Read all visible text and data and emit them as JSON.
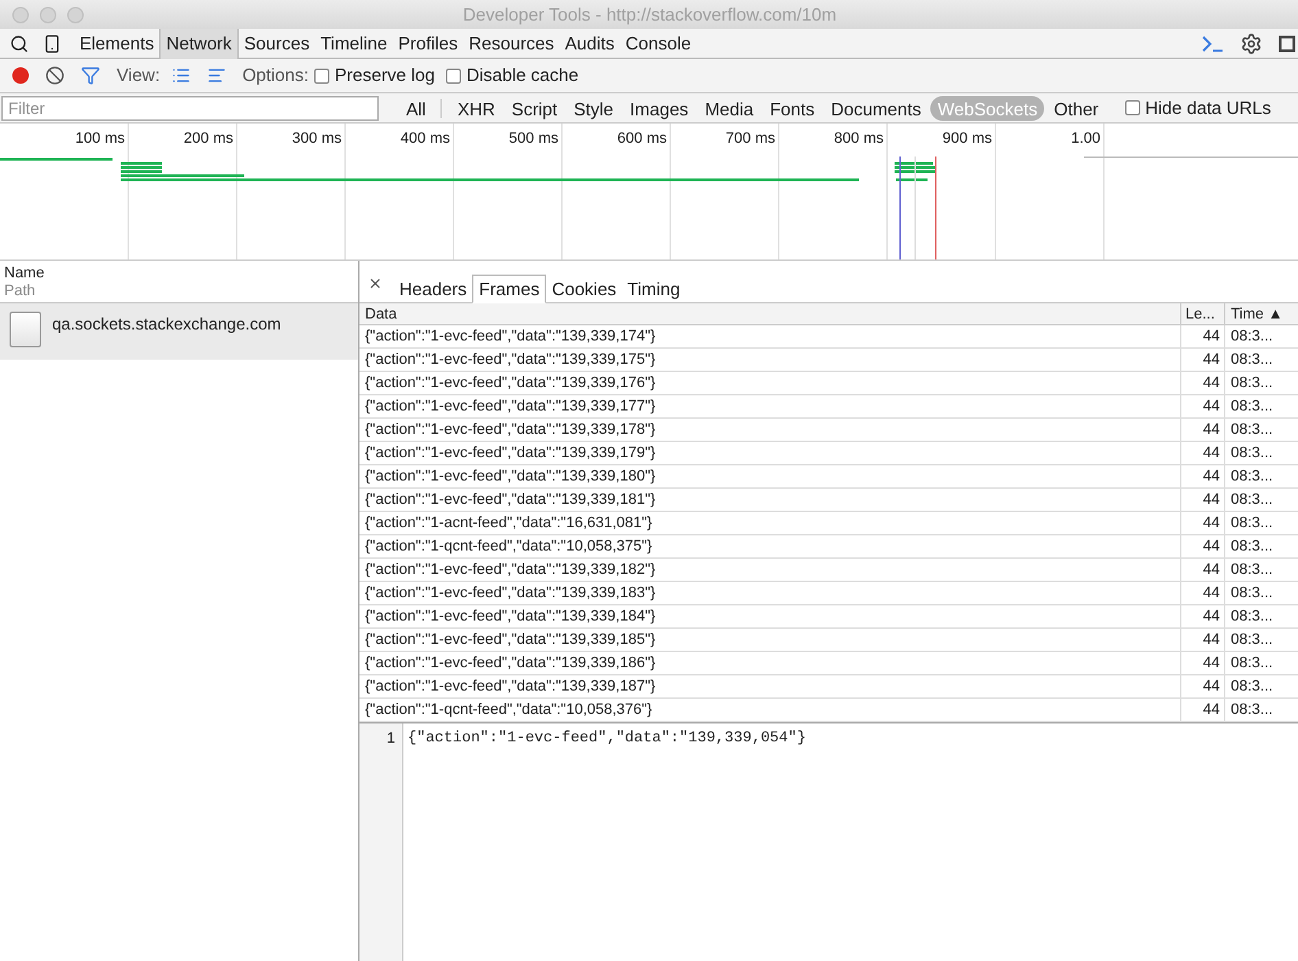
{
  "window": {
    "title": "Developer Tools - http://stackoverflow.com/10m"
  },
  "panels": [
    {
      "label": "Elements",
      "selected": false
    },
    {
      "label": "Network",
      "selected": true
    },
    {
      "label": "Sources",
      "selected": false
    },
    {
      "label": "Timeline",
      "selected": false
    },
    {
      "label": "Profiles",
      "selected": false
    },
    {
      "label": "Resources",
      "selected": false
    },
    {
      "label": "Audits",
      "selected": false
    },
    {
      "label": "Console",
      "selected": false
    }
  ],
  "toolbar": {
    "recording": true,
    "view_label": "View:",
    "options_label": "Options:",
    "options": [
      {
        "label": "Preserve log",
        "checked": false
      },
      {
        "label": "Disable cache",
        "checked": false
      }
    ]
  },
  "filter": {
    "placeholder": "Filter",
    "types": [
      {
        "label": "All",
        "selected": false
      },
      {
        "label": "XHR",
        "selected": false
      },
      {
        "label": "Script",
        "selected": false
      },
      {
        "label": "Style",
        "selected": false
      },
      {
        "label": "Images",
        "selected": false
      },
      {
        "label": "Media",
        "selected": false
      },
      {
        "label": "Fonts",
        "selected": false
      },
      {
        "label": "Documents",
        "selected": false
      },
      {
        "label": "WebSockets",
        "selected": true
      },
      {
        "label": "Other",
        "selected": false
      }
    ],
    "hide_data_urls": {
      "label": "Hide data URLs",
      "checked": false
    }
  },
  "timeline": {
    "ticks": [
      "100 ms",
      "200 ms",
      "300 ms",
      "400 ms",
      "500 ms",
      "600 ms",
      "700 ms",
      "800 ms",
      "900 ms",
      "1.00"
    ]
  },
  "requests": {
    "columns": [
      "Name",
      "Path"
    ],
    "rows": [
      {
        "name": "qa.sockets.stackexchange.com",
        "selected": true
      }
    ]
  },
  "detail_tabs": [
    {
      "label": "Headers",
      "selected": false
    },
    {
      "label": "Frames",
      "selected": true
    },
    {
      "label": "Cookies",
      "selected": false
    },
    {
      "label": "Timing",
      "selected": false
    }
  ],
  "frames": {
    "columns": [
      "Data",
      "Le...",
      "Time ▲"
    ],
    "rows": [
      [
        "{\"action\":\"1-evc-feed\",\"data\":\"139,339,174\"}",
        "44",
        "08:3..."
      ],
      [
        "{\"action\":\"1-evc-feed\",\"data\":\"139,339,175\"}",
        "44",
        "08:3..."
      ],
      [
        "{\"action\":\"1-evc-feed\",\"data\":\"139,339,176\"}",
        "44",
        "08:3..."
      ],
      [
        "{\"action\":\"1-evc-feed\",\"data\":\"139,339,177\"}",
        "44",
        "08:3..."
      ],
      [
        "{\"action\":\"1-evc-feed\",\"data\":\"139,339,178\"}",
        "44",
        "08:3..."
      ],
      [
        "{\"action\":\"1-evc-feed\",\"data\":\"139,339,179\"}",
        "44",
        "08:3..."
      ],
      [
        "{\"action\":\"1-evc-feed\",\"data\":\"139,339,180\"}",
        "44",
        "08:3..."
      ],
      [
        "{\"action\":\"1-evc-feed\",\"data\":\"139,339,181\"}",
        "44",
        "08:3..."
      ],
      [
        "{\"action\":\"1-acnt-feed\",\"data\":\"16,631,081\"}",
        "44",
        "08:3..."
      ],
      [
        "{\"action\":\"1-qcnt-feed\",\"data\":\"10,058,375\"}",
        "44",
        "08:3..."
      ],
      [
        "{\"action\":\"1-evc-feed\",\"data\":\"139,339,182\"}",
        "44",
        "08:3..."
      ],
      [
        "{\"action\":\"1-evc-feed\",\"data\":\"139,339,183\"}",
        "44",
        "08:3..."
      ],
      [
        "{\"action\":\"1-evc-feed\",\"data\":\"139,339,184\"}",
        "44",
        "08:3..."
      ],
      [
        "{\"action\":\"1-evc-feed\",\"data\":\"139,339,185\"}",
        "44",
        "08:3..."
      ],
      [
        "{\"action\":\"1-evc-feed\",\"data\":\"139,339,186\"}",
        "44",
        "08:3..."
      ],
      [
        "{\"action\":\"1-evc-feed\",\"data\":\"139,339,187\"}",
        "44",
        "08:3..."
      ],
      [
        "{\"action\":\"1-qcnt-feed\",\"data\":\"10,058,376\"}",
        "44",
        "08:3..."
      ]
    ]
  },
  "frame_view": {
    "lines": [
      {
        "number": "1",
        "text": "{\"action\":\"1-evc-feed\",\"data\":\"139,339,054\"}"
      }
    ]
  }
}
